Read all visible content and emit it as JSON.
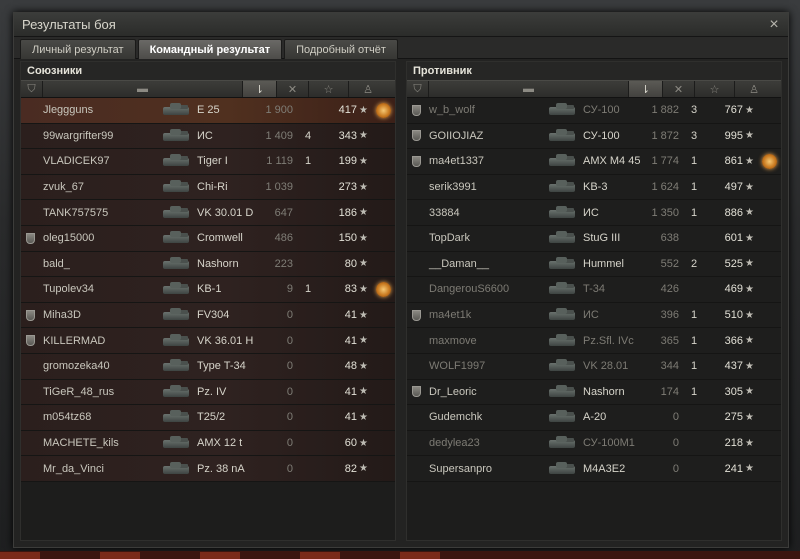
{
  "window": {
    "title": "Результаты боя",
    "close_symbol": "×"
  },
  "tabs": [
    {
      "label": "Личный результат",
      "active": false
    },
    {
      "label": "Командный результат",
      "active": true
    },
    {
      "label": "Подробный отчёт",
      "active": false
    }
  ],
  "allies": {
    "title": "Союзники",
    "rows": [
      {
        "name": "Jleggguns",
        "tank": "E 25",
        "damage": "1 900",
        "kills": "",
        "xp": "417",
        "medal": true,
        "clan": false,
        "self": true,
        "dim": false
      },
      {
        "name": "99wargrifter99",
        "tank": "ИС",
        "damage": "1 409",
        "kills": "4",
        "xp": "343",
        "medal": false,
        "clan": false,
        "self": false,
        "dim": false
      },
      {
        "name": "VLADICEK97",
        "tank": "Tiger I",
        "damage": "1 119",
        "kills": "1",
        "xp": "199",
        "medal": false,
        "clan": false,
        "self": false,
        "dim": false
      },
      {
        "name": "zvuk_67",
        "tank": "Chi-Ri",
        "damage": "1 039",
        "kills": "",
        "xp": "273",
        "medal": false,
        "clan": false,
        "self": false,
        "dim": false
      },
      {
        "name": "TANK757575",
        "tank": "VK 30.01 D",
        "damage": "647",
        "kills": "",
        "xp": "186",
        "medal": false,
        "clan": false,
        "self": false,
        "dim": false
      },
      {
        "name": "oleg15000",
        "tank": "Cromwell",
        "damage": "486",
        "kills": "",
        "xp": "150",
        "medal": false,
        "clan": true,
        "self": false,
        "dim": false
      },
      {
        "name": "bald_",
        "tank": "Nashorn",
        "damage": "223",
        "kills": "",
        "xp": "80",
        "medal": false,
        "clan": false,
        "self": false,
        "dim": false
      },
      {
        "name": "Tupolev34",
        "tank": "KB-1",
        "damage": "9",
        "kills": "1",
        "xp": "83",
        "medal": true,
        "clan": false,
        "self": false,
        "dim": false
      },
      {
        "name": "Miha3D",
        "tank": "FV304",
        "damage": "0",
        "kills": "",
        "xp": "41",
        "medal": false,
        "clan": true,
        "self": false,
        "dim": false
      },
      {
        "name": "KILLERMAD",
        "tank": "VK 36.01 H",
        "damage": "0",
        "kills": "",
        "xp": "41",
        "medal": false,
        "clan": true,
        "self": false,
        "dim": false
      },
      {
        "name": "gromozeka40",
        "tank": "Type T-34",
        "damage": "0",
        "kills": "",
        "xp": "48",
        "medal": false,
        "clan": false,
        "self": false,
        "dim": false
      },
      {
        "name": "TiGeR_48_rus",
        "tank": "Pz. IV",
        "damage": "0",
        "kills": "",
        "xp": "41",
        "medal": false,
        "clan": false,
        "self": false,
        "dim": false
      },
      {
        "name": "m054tz68",
        "tank": "T25/2",
        "damage": "0",
        "kills": "",
        "xp": "41",
        "medal": false,
        "clan": false,
        "self": false,
        "dim": false
      },
      {
        "name": "MACHETE_kils",
        "tank": "AMX 12 t",
        "damage": "0",
        "kills": "",
        "xp": "60",
        "medal": false,
        "clan": false,
        "self": false,
        "dim": false
      },
      {
        "name": "Mr_da_Vinci",
        "tank": "Pz. 38 nA",
        "damage": "0",
        "kills": "",
        "xp": "82",
        "medal": false,
        "clan": false,
        "self": false,
        "dim": false
      }
    ]
  },
  "enemies": {
    "title": "Противник",
    "rows": [
      {
        "name": "w_b_wolf",
        "tank": "СУ-100",
        "damage": "1 882",
        "kills": "3",
        "xp": "767",
        "medal": false,
        "clan": true,
        "dim": true
      },
      {
        "name": "GOIIOJIAZ",
        "tank": "СУ-100",
        "damage": "1 872",
        "kills": "3",
        "xp": "995",
        "medal": false,
        "clan": true,
        "dim": false
      },
      {
        "name": "ma4et1337",
        "tank": "AMX M4 45",
        "damage": "1 774",
        "kills": "1",
        "xp": "861",
        "medal": true,
        "clan": true,
        "dim": false
      },
      {
        "name": "serik3991",
        "tank": "KB-3",
        "damage": "1 624",
        "kills": "1",
        "xp": "497",
        "medal": false,
        "clan": false,
        "dim": false
      },
      {
        "name": "33884",
        "tank": "ИС",
        "damage": "1 350",
        "kills": "1",
        "xp": "886",
        "medal": false,
        "clan": false,
        "dim": false
      },
      {
        "name": "TopDark",
        "tank": "StuG III",
        "damage": "638",
        "kills": "",
        "xp": "601",
        "medal": false,
        "clan": false,
        "dim": false
      },
      {
        "name": "__Daman__",
        "tank": "Hummel",
        "damage": "552",
        "kills": "2",
        "xp": "525",
        "medal": false,
        "clan": false,
        "dim": false
      },
      {
        "name": "DangerouS6600",
        "tank": "T-34",
        "damage": "426",
        "kills": "",
        "xp": "469",
        "medal": false,
        "clan": false,
        "dim": true
      },
      {
        "name": "ma4et1k",
        "tank": "ИС",
        "damage": "396",
        "kills": "1",
        "xp": "510",
        "medal": false,
        "clan": true,
        "dim": true
      },
      {
        "name": "maxmove",
        "tank": "Pz.Sfl. IVc",
        "damage": "365",
        "kills": "1",
        "xp": "366",
        "medal": false,
        "clan": false,
        "dim": true
      },
      {
        "name": "WOLF1997",
        "tank": "VK 28.01",
        "damage": "344",
        "kills": "1",
        "xp": "437",
        "medal": false,
        "clan": false,
        "dim": true
      },
      {
        "name": "Dr_Leoric",
        "tank": "Nashorn",
        "damage": "174",
        "kills": "1",
        "xp": "305",
        "medal": false,
        "clan": true,
        "dim": false
      },
      {
        "name": "Gudemchk",
        "tank": "A-20",
        "damage": "0",
        "kills": "",
        "xp": "275",
        "medal": false,
        "clan": false,
        "dim": false
      },
      {
        "name": "dedylea23",
        "tank": "СУ-100М1",
        "damage": "0",
        "kills": "",
        "xp": "218",
        "medal": false,
        "clan": false,
        "dim": true
      },
      {
        "name": "Supersanpro",
        "tank": "M4A3E2",
        "damage": "0",
        "kills": "",
        "xp": "241",
        "medal": false,
        "clan": false,
        "dim": false
      }
    ]
  },
  "icons": {
    "header_clan": "clan-shield-icon",
    "header_tank": "tank-icon",
    "header_damage": "damage-icon",
    "header_kills": "kills-icon",
    "header_xp": "star-icon",
    "header_medal": "medal-icon",
    "star_glyph": "★"
  }
}
